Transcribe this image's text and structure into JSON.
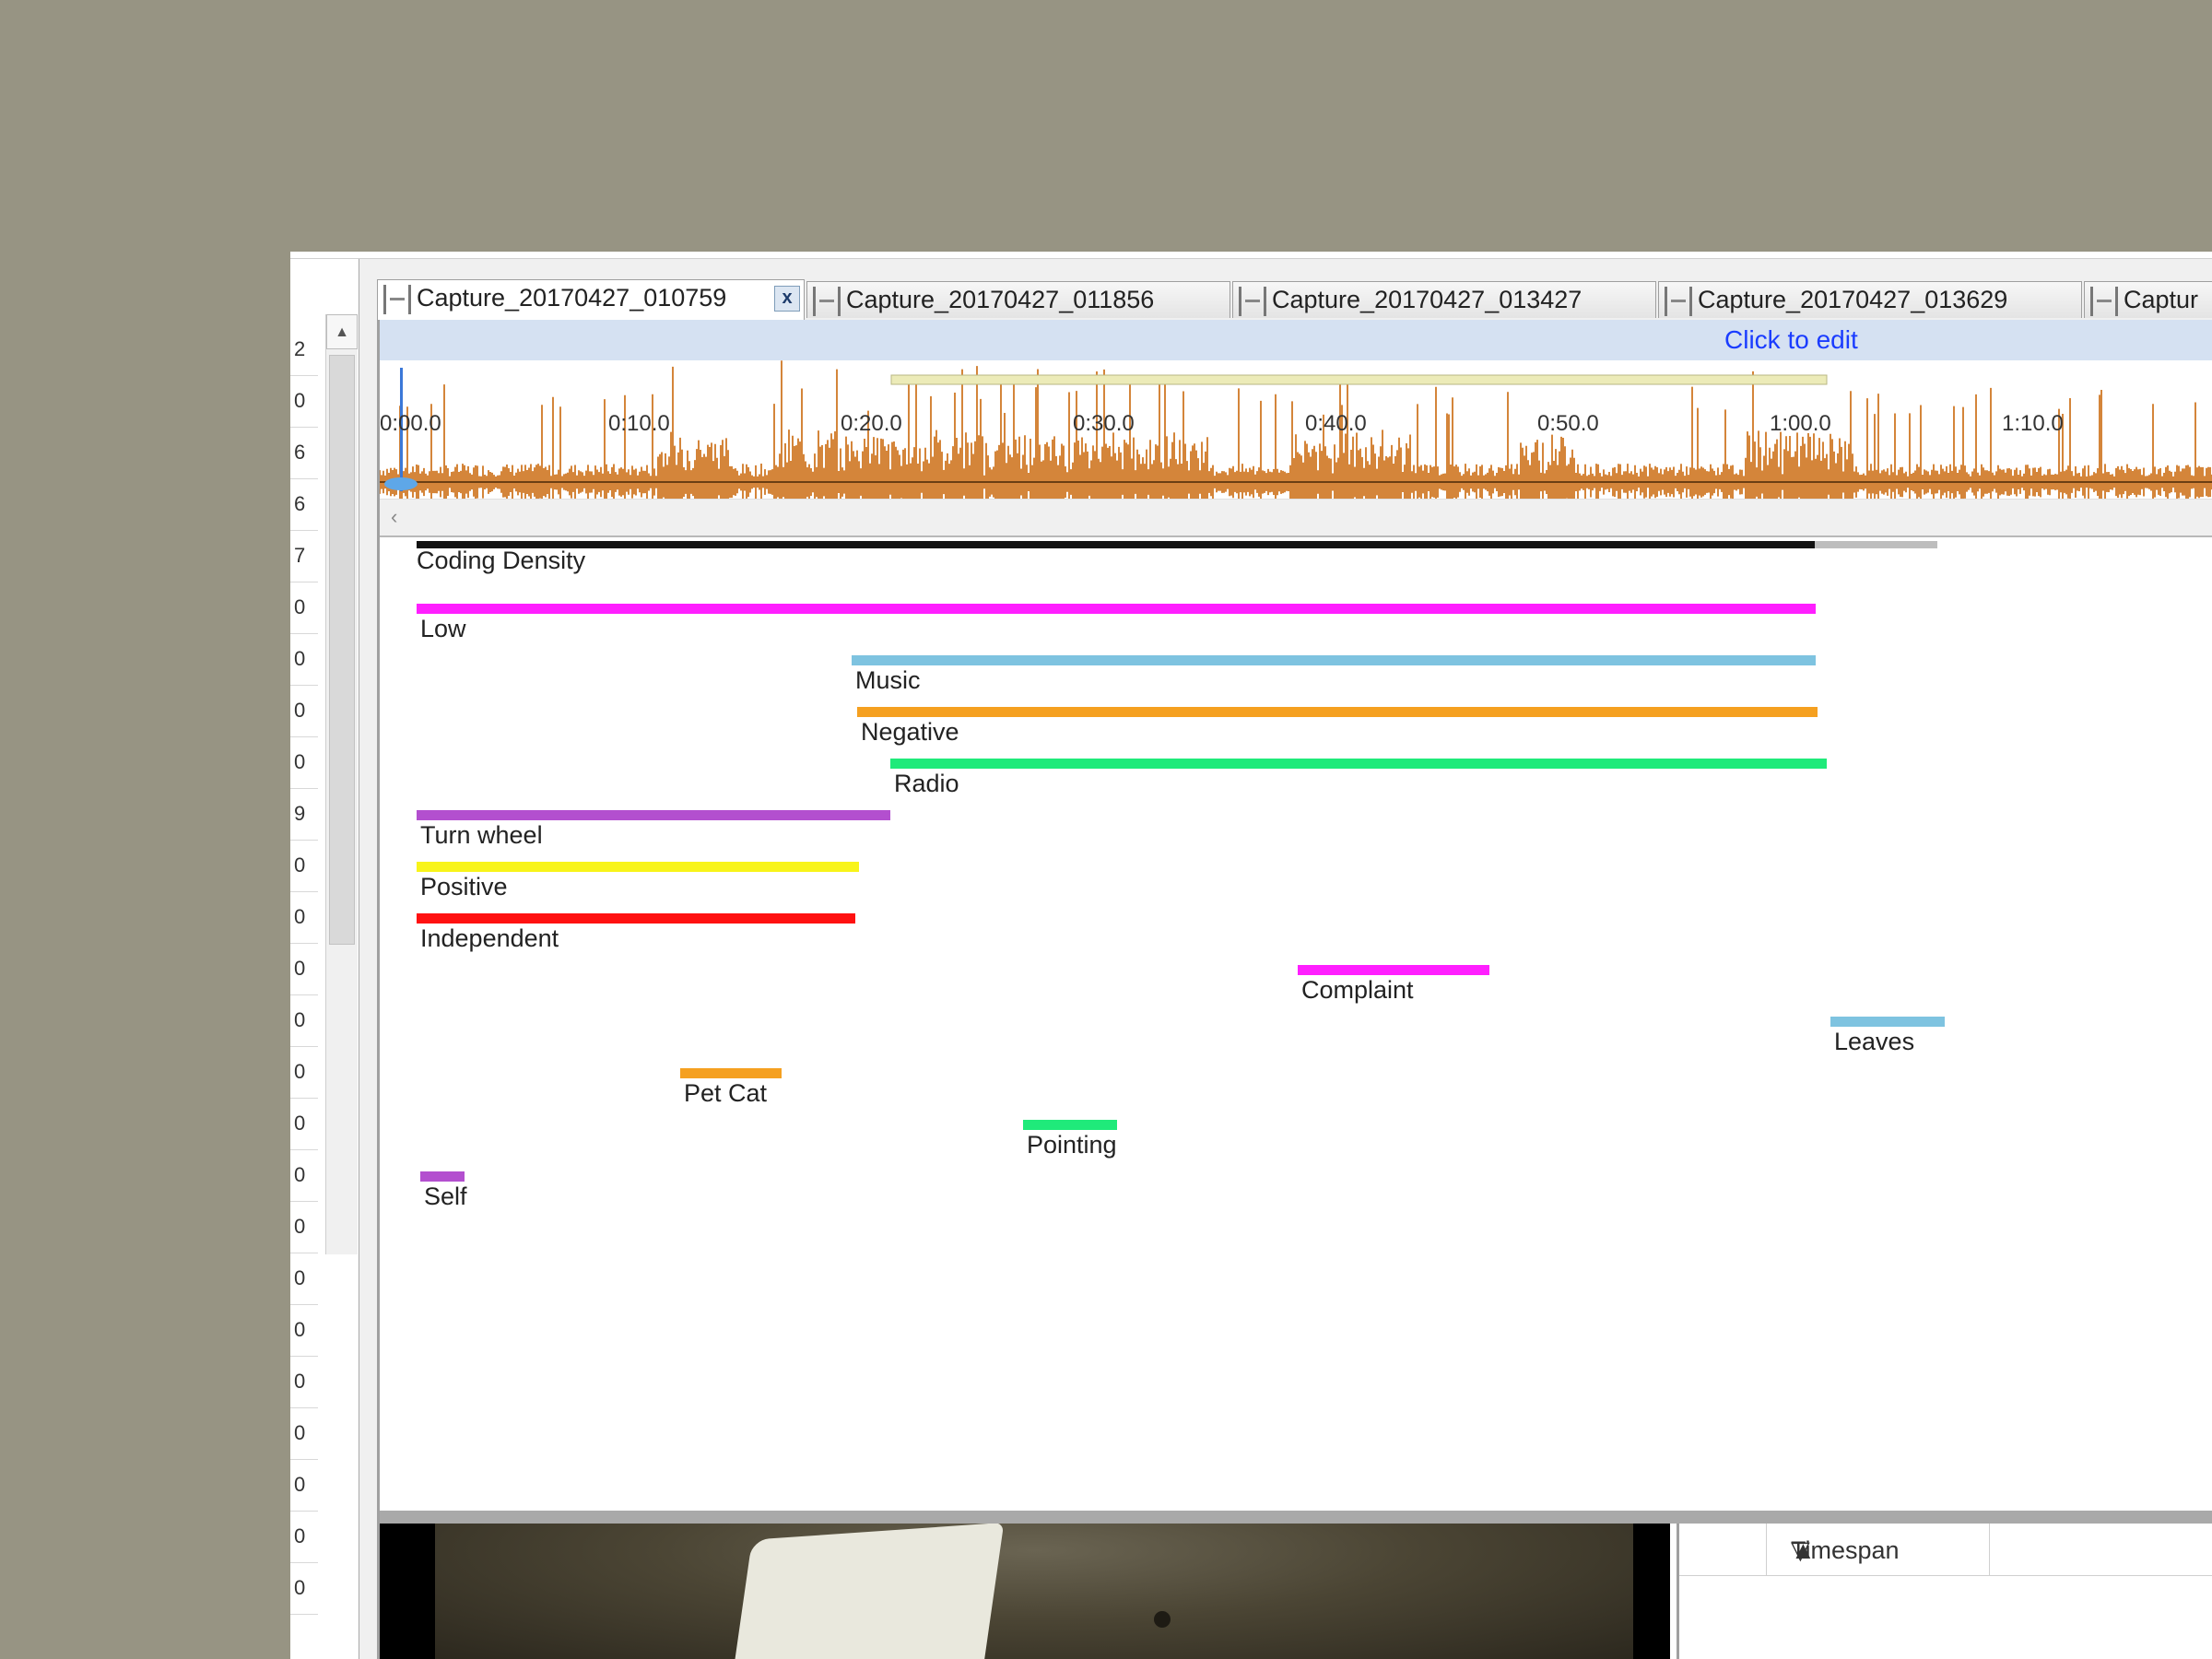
{
  "left_list": {
    "values": [
      "2",
      "0",
      "6",
      "6",
      "7",
      "0",
      "0",
      "0",
      "0",
      "9",
      "0",
      "0",
      "0",
      "0",
      "0",
      "0",
      "0",
      "0",
      "0",
      "0",
      "0",
      "0",
      "0",
      "0",
      "0"
    ]
  },
  "tabs": [
    {
      "label": "Capture_20170427_010759",
      "active": true
    },
    {
      "label": "Capture_20170427_011856",
      "active": false
    },
    {
      "label": "Capture_20170427_013427",
      "active": false
    },
    {
      "label": "Capture_20170427_013629",
      "active": false
    },
    {
      "label": "Captur",
      "active": false
    }
  ],
  "editbar": {
    "label": "Click to edit"
  },
  "timeline": {
    "ticks": [
      "0:00.0",
      "0:10.0",
      "0:20.0",
      "0:30.0",
      "0:40.0",
      "0:50.0",
      "1:00.0",
      "1:10.0"
    ],
    "waveform_color": "#d4853a"
  },
  "coding": {
    "density_label": "Coding Density",
    "nodes": [
      {
        "label": "Low",
        "color": "#ff1fff"
      },
      {
        "label": "Music",
        "color": "#7ec3e0"
      },
      {
        "label": "Negative",
        "color": "#f5a020"
      },
      {
        "label": "Radio",
        "color": "#1fea7a"
      },
      {
        "label": "Turn wheel",
        "color": "#b34fcf"
      },
      {
        "label": "Positive",
        "color": "#f8f41a"
      },
      {
        "label": "Independent",
        "color": "#ff1111"
      },
      {
        "label": "Complaint",
        "color": "#ff1fff"
      },
      {
        "label": "Leaves",
        "color": "#7ec3e0"
      },
      {
        "label": "Pet Cat",
        "color": "#f5a020"
      },
      {
        "label": "Pointing",
        "color": "#1fea7a"
      },
      {
        "label": "Self",
        "color": "#b34fcf"
      }
    ]
  },
  "timespan_panel": {
    "column_header": "Timespan"
  }
}
